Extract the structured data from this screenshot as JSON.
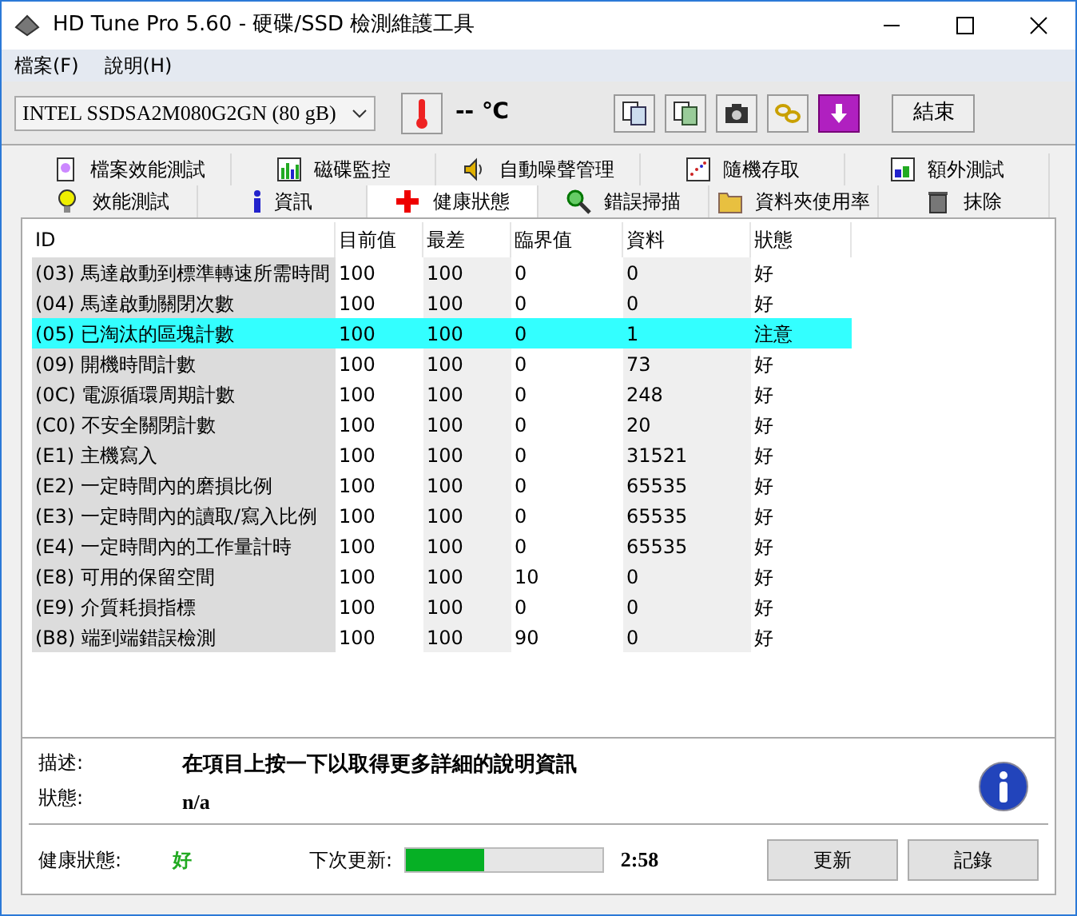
{
  "window": {
    "title": "HD Tune Pro 5.60 - 硬碟/SSD 檢測維護工具"
  },
  "menu": [
    "檔案(F)",
    "說明(H)"
  ],
  "toolbar": {
    "drive": "INTEL SSDSA2M080G2GN (80 gB)",
    "temperature": "-- ℃",
    "exit_button": "結束"
  },
  "tabs_row_1": [
    {
      "label": "檔案效能測試",
      "selected": false
    },
    {
      "label": "磁碟監控",
      "selected": false
    },
    {
      "label": "自動噪聲管理",
      "selected": false
    },
    {
      "label": "隨機存取",
      "selected": false
    },
    {
      "label": "額外測試",
      "selected": false
    }
  ],
  "tabs_row_2": [
    {
      "label": "效能測試",
      "selected": false
    },
    {
      "label": "資訊",
      "selected": false
    },
    {
      "label": "健康狀態",
      "selected": true
    },
    {
      "label": "錯誤掃描",
      "selected": false
    },
    {
      "label": "資料夾使用率",
      "selected": false
    },
    {
      "label": "抹除",
      "selected": false
    }
  ],
  "table": {
    "columns": [
      "ID",
      "目前值",
      "最差",
      "臨界值",
      "資料",
      "狀態"
    ],
    "rows": [
      {
        "cells": [
          "(03) 馬達啟動到標準轉速所需時間",
          "100",
          "100",
          "0",
          "0",
          "好"
        ],
        "warning": false
      },
      {
        "cells": [
          "(04) 馬達啟動關閉次數",
          "100",
          "100",
          "0",
          "0",
          "好"
        ],
        "warning": false
      },
      {
        "cells": [
          "(05) 已淘汰的區塊計數",
          "100",
          "100",
          "0",
          "1",
          "注意"
        ],
        "warning": true
      },
      {
        "cells": [
          "(09) 開機時間計數",
          "100",
          "100",
          "0",
          "73",
          "好"
        ],
        "warning": false
      },
      {
        "cells": [
          "(0C) 電源循環周期計數",
          "100",
          "100",
          "0",
          "248",
          "好"
        ],
        "warning": false
      },
      {
        "cells": [
          "(C0) 不安全關閉計數",
          "100",
          "100",
          "0",
          "20",
          "好"
        ],
        "warning": false
      },
      {
        "cells": [
          "(E1) 主機寫入",
          "100",
          "100",
          "0",
          "31521",
          "好"
        ],
        "warning": false
      },
      {
        "cells": [
          "(E2) 一定時間內的磨損比例",
          "100",
          "100",
          "0",
          "65535",
          "好"
        ],
        "warning": false
      },
      {
        "cells": [
          "(E3) 一定時間內的讀取/寫入比例",
          "100",
          "100",
          "0",
          "65535",
          "好"
        ],
        "warning": false
      },
      {
        "cells": [
          "(E4) 一定時間內的工作量計時",
          "100",
          "100",
          "0",
          "65535",
          "好"
        ],
        "warning": false
      },
      {
        "cells": [
          "(E8) 可用的保留空間",
          "100",
          "100",
          "10",
          "0",
          "好"
        ],
        "warning": false
      },
      {
        "cells": [
          "(E9) 介質耗損指標",
          "100",
          "100",
          "0",
          "0",
          "好"
        ],
        "warning": false
      },
      {
        "cells": [
          "(B8) 端到端錯誤檢測",
          "100",
          "100",
          "90",
          "0",
          "好"
        ],
        "warning": false
      }
    ]
  },
  "details": {
    "description_label": "描述:",
    "description": "在項目上按一下以取得更多詳細的說明資訊",
    "status_label": "狀態:",
    "status": "n/a"
  },
  "footer": {
    "health_label": "健康狀態:",
    "health": "好",
    "next_update_label": "下次更新:",
    "countdown": {
      "level": 0.4
    },
    "time": "2:58",
    "buttons": [
      "更新",
      "記錄"
    ]
  }
}
